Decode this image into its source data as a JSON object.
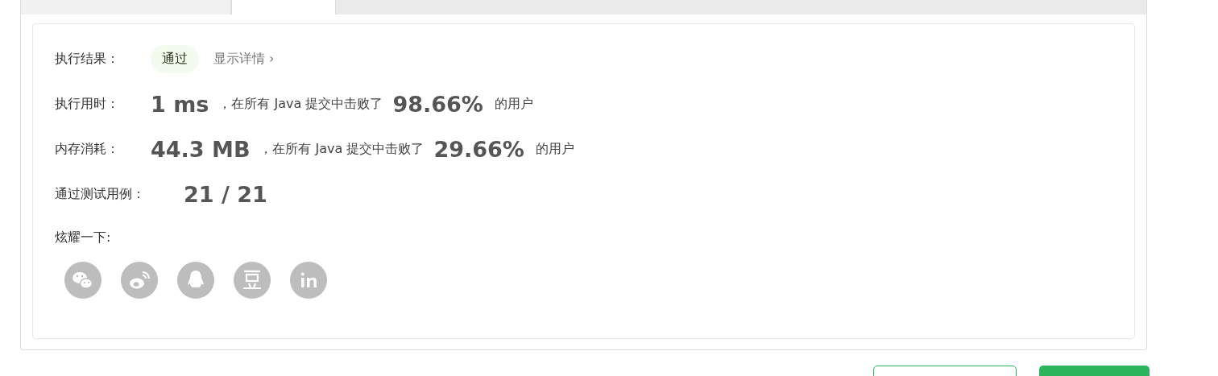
{
  "tabs": [
    {
      "selected": false
    },
    {
      "selected": true
    }
  ],
  "result": {
    "label": "执行结果：",
    "status": "通过",
    "details_link": "显示详情",
    "details_arrow": "›"
  },
  "stats": [
    {
      "label": "执行用时：",
      "value": "1 ms",
      "middle": "，在所有 Java 提交中击败了",
      "percent": "98.66%",
      "suffix": "的用户"
    },
    {
      "label": "内存消耗：",
      "value": "44.3 MB",
      "middle": "，在所有 Java 提交中击败了",
      "percent": "29.66%",
      "suffix": "的用户"
    }
  ],
  "test_cases": {
    "label": "通过测试用例：",
    "value": "21 / 21"
  },
  "share": {
    "label": "炫耀一下:",
    "icons": [
      {
        "kind": "wechat"
      },
      {
        "kind": "weibo"
      },
      {
        "kind": "qq"
      },
      {
        "kind": "douban"
      },
      {
        "kind": "linkedin"
      }
    ]
  },
  "buttons": [
    {
      "kind": "outline"
    },
    {
      "kind": "primary"
    }
  ]
}
